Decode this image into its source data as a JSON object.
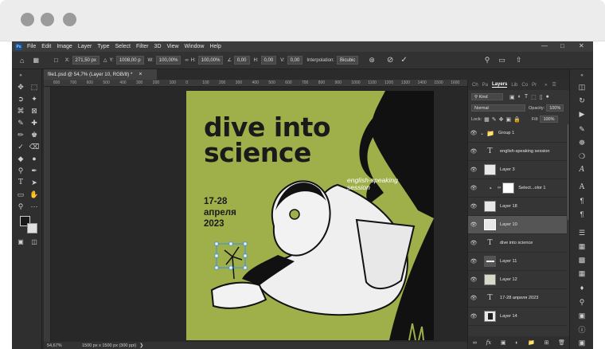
{
  "menubar": {
    "logo": "Ps",
    "items": [
      "File",
      "Edit",
      "Image",
      "Layer",
      "Type",
      "Select",
      "Filter",
      "3D",
      "View",
      "Window",
      "Help"
    ]
  },
  "options": {
    "x_label": "X:",
    "x_value": "271,50 px",
    "y_label": "Y:",
    "y_value": "1008,00 p",
    "w_label": "W:",
    "w_value": "100,00%",
    "h_label": "H:",
    "h_value": "100,00%",
    "angle_value": "0,00",
    "hskew_label": "H:",
    "hskew_value": "0,00",
    "vskew_label": "V:",
    "vskew_value": "0,00",
    "interp_label": "Interpolation:",
    "interp_value": "Bicubic"
  },
  "document": {
    "tab_title": "file1.psd @ 54,7% (Layer 10, RGB/8) *",
    "ruler_ticks": [
      "800",
      "700",
      "600",
      "500",
      "400",
      "300",
      "200",
      "100",
      "0",
      "100",
      "200",
      "300",
      "400",
      "500",
      "600",
      "700",
      "800",
      "900",
      "1000",
      "1100",
      "1200",
      "1300",
      "1400",
      "1500",
      "1600"
    ],
    "zoom": "54,67%",
    "doc_size": "1500 px x 1500 px (300 ppi)"
  },
  "artwork": {
    "title_line1": "dive into",
    "title_line2": "science",
    "subtitle_line1": "english-speaking",
    "subtitle_line2": "session",
    "date_line1": "17-28",
    "date_line2": "апреля",
    "date_line3": "2023"
  },
  "panel": {
    "tabs": [
      "Ch",
      "Pa",
      "Layers",
      "Lib",
      "Co",
      "Pr"
    ],
    "kind_label": "Kind",
    "blend_mode": "Normal",
    "opacity_label": "Opacity:",
    "opacity_value": "100%",
    "lock_label": "Lock:",
    "fill_label": "Fill:",
    "fill_value": "100%",
    "layers": [
      {
        "name": "Group 1",
        "kind": "group"
      },
      {
        "name": "english-speaking session",
        "kind": "type"
      },
      {
        "name": "Layer 3",
        "kind": "pixel"
      },
      {
        "name": "Select...olor 1",
        "kind": "adjust"
      },
      {
        "name": "Layer 18",
        "kind": "pixel"
      },
      {
        "name": "Layer 10",
        "kind": "pixel",
        "selected": true
      },
      {
        "name": "dive into science",
        "kind": "type"
      },
      {
        "name": "Layer 11",
        "kind": "pixel"
      },
      {
        "name": "Layer 12",
        "kind": "pixel"
      },
      {
        "name": "17-28 апреля 2023",
        "kind": "type"
      },
      {
        "name": "Layer 14",
        "kind": "pixel"
      }
    ]
  },
  "colors": {
    "artwork_bg": "#9fb04a",
    "ui_dark": "#2b2b2b",
    "panel_bg": "#353535",
    "selected_layer": "#555555"
  }
}
